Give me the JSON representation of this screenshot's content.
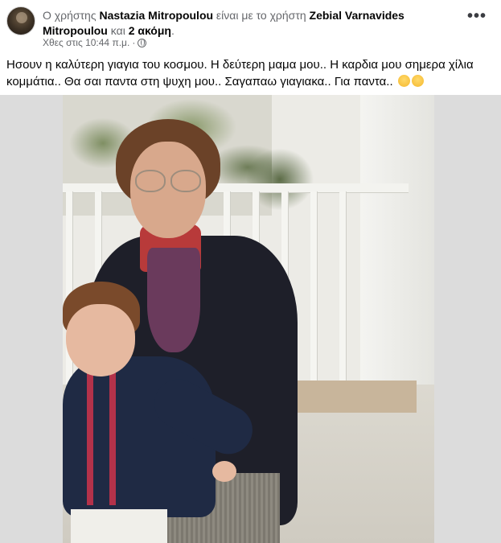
{
  "post": {
    "header": {
      "prefix": "Ο χρήστης ",
      "author": "Nastazia Mitropoulou",
      "middle": " είναι με το χρήστη ",
      "tagged": "Zebial Varnavides Mitropoulou",
      "conj": " και ",
      "others": "2 ακόμη",
      "suffix": "."
    },
    "timestamp": "Χθες στις 10:44 π.μ.",
    "separator": "·",
    "audience_icon": "globe-icon",
    "more_icon": "more-options-icon",
    "more_label": "•••",
    "caption": "Ησουν η καλύτερη γιαγια του κοσμου. Η δεύτερη μαμα μου.. Η καρδια μου σημερα χίλια κομμάτια.. Θα σαι παντα στη ψυχη μου.. Σαγαπαω γιαγιακα.. Για παντα..",
    "caption_emojis": [
      "sad-tear-emoji",
      "pensive-emoji"
    ],
    "photo": "vintage-photo-grandmother-with-child"
  },
  "colors": {
    "text_primary": "#050505",
    "text_secondary": "#65676b",
    "photo_border": "#dcdcdc"
  }
}
